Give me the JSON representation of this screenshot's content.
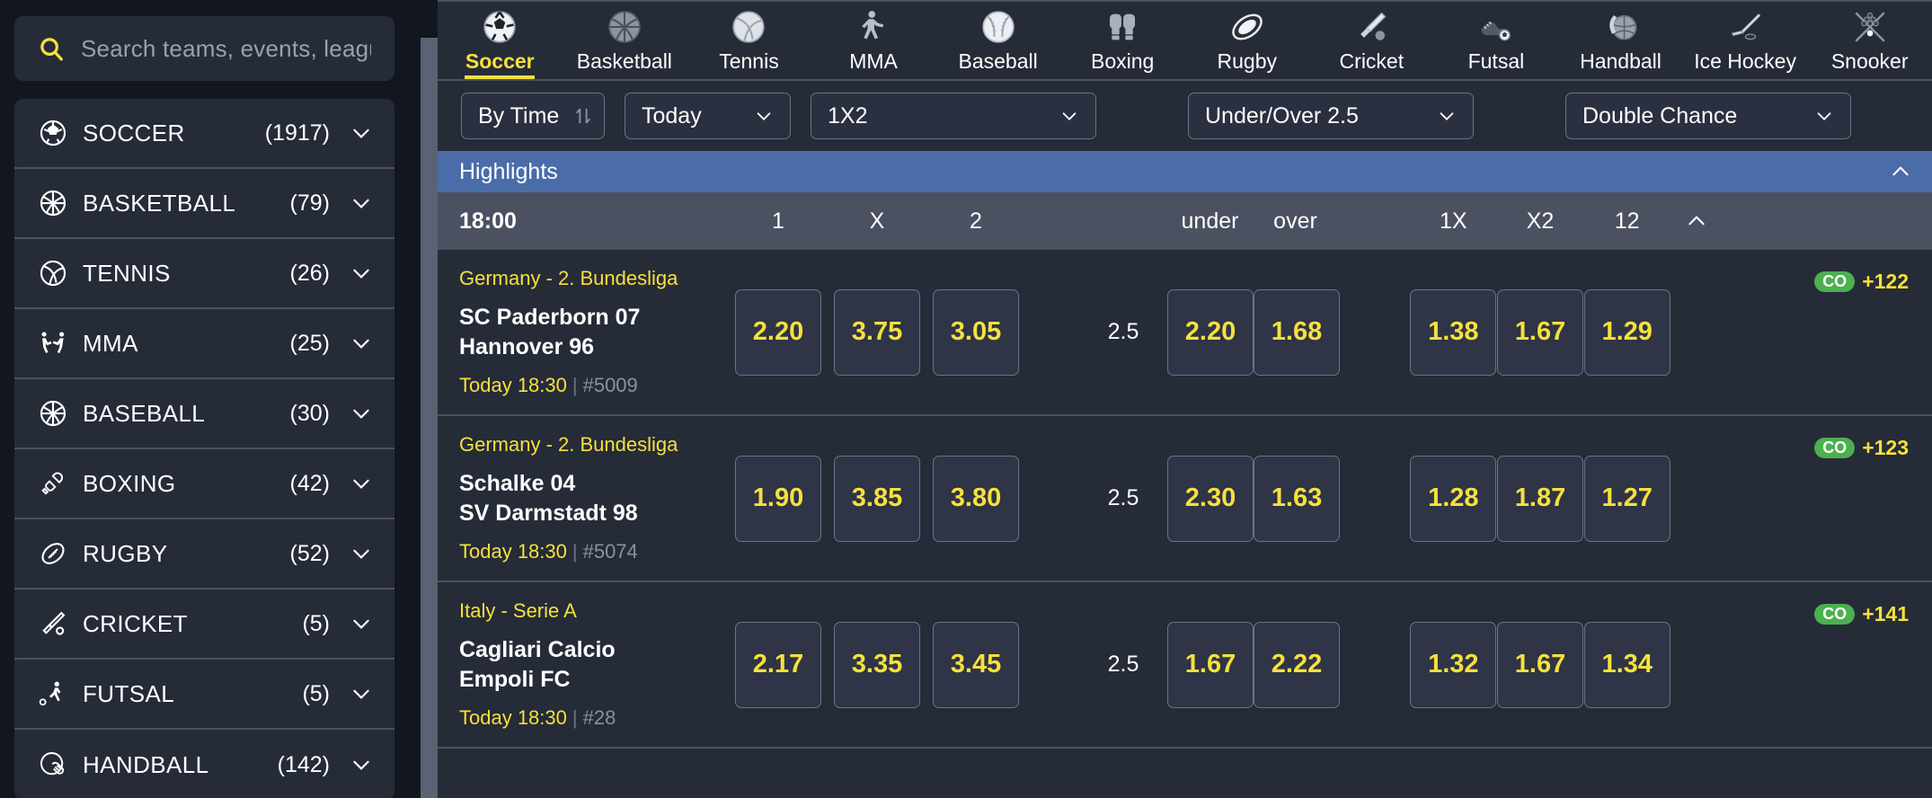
{
  "colors": {
    "accent_yellow": "#f5e13c",
    "highlight_blue": "#4a6ca8",
    "panel_bg": "#262b38",
    "page_bg": "#12161f",
    "row_header_bg": "#4b5161",
    "badge_green": "#4caf50"
  },
  "sidebar": {
    "search": {
      "placeholder": "Search teams, events, leagues",
      "icon": "search-icon",
      "value": ""
    },
    "items": [
      {
        "label": "SOCCER",
        "count": "(1917)",
        "icon": "soccer-ball-icon"
      },
      {
        "label": "BASKETBALL",
        "count": "(79)",
        "icon": "basketball-icon"
      },
      {
        "label": "TENNIS",
        "count": "(26)",
        "icon": "tennis-ball-icon"
      },
      {
        "label": "MMA",
        "count": "(25)",
        "icon": "mma-fighters-icon"
      },
      {
        "label": "BASEBALL",
        "count": "(30)",
        "icon": "baseball-icon"
      },
      {
        "label": "BOXING",
        "count": "(42)",
        "icon": "boxing-gloves-icon"
      },
      {
        "label": "RUGBY",
        "count": "(52)",
        "icon": "rugby-ball-icon"
      },
      {
        "label": "CRICKET",
        "count": "(5)",
        "icon": "cricket-bat-icon"
      },
      {
        "label": "FUTSAL",
        "count": "(5)",
        "icon": "futsal-player-icon"
      },
      {
        "label": "HANDBALL",
        "count": "(142)",
        "icon": "handball-icon"
      }
    ]
  },
  "topnav": {
    "items": [
      {
        "label": "Soccer",
        "icon": "soccer-ball-icon",
        "active": true
      },
      {
        "label": "Basketball",
        "icon": "basketball-icon",
        "active": false
      },
      {
        "label": "Tennis",
        "icon": "tennis-ball-icon",
        "active": false
      },
      {
        "label": "MMA",
        "icon": "mma-fighter-icon",
        "active": false
      },
      {
        "label": "Baseball",
        "icon": "baseball-icon",
        "active": false
      },
      {
        "label": "Boxing",
        "icon": "boxing-gloves-icon",
        "active": false
      },
      {
        "label": "Rugby",
        "icon": "rugby-ball-icon",
        "active": false
      },
      {
        "label": "Cricket",
        "icon": "cricket-bat-icon",
        "active": false
      },
      {
        "label": "Futsal",
        "icon": "futsal-boot-icon",
        "active": false
      },
      {
        "label": "Handball",
        "icon": "handball-icon",
        "active": false
      },
      {
        "label": "Ice Hockey",
        "icon": "hockey-stick-icon",
        "active": false
      },
      {
        "label": "Snooker",
        "icon": "snooker-cues-icon",
        "active": false
      }
    ]
  },
  "filters": {
    "sort": {
      "label": "By Time",
      "icon": "sort-updown-icon"
    },
    "day": {
      "label": "Today",
      "icon": "chevron-down-icon"
    },
    "market1": {
      "label": "1X2",
      "icon": "chevron-down-icon"
    },
    "market2": {
      "label": "Under/Over 2.5",
      "icon": "chevron-down-icon"
    },
    "market3": {
      "label": "Double Chance",
      "icon": "chevron-down-icon"
    }
  },
  "highlights": {
    "title": "Highlights",
    "collapse_icon": "chevron-up-icon"
  },
  "column_header": {
    "time": "18:00",
    "c1": "1",
    "cx": "X",
    "c2": "2",
    "line": "",
    "under": "under",
    "over": "over",
    "c1x": "1X",
    "cx2": "X2",
    "c12": "12",
    "collapse_icon": "chevron-up-icon"
  },
  "matches": [
    {
      "league": "Germany - 2. Bundesliga",
      "home": "SC Paderborn 07",
      "away": "Hannover 96",
      "kickoff": "Today 18:30",
      "sep": "|",
      "event_id": "#5009",
      "badge_label": "CO",
      "more_markets": "+122",
      "odds_1": "2.20",
      "odds_x": "3.75",
      "odds_2": "3.05",
      "line": "2.5",
      "odds_under": "2.20",
      "odds_over": "1.68",
      "odds_1x": "1.38",
      "odds_x2": "1.67",
      "odds_12": "1.29"
    },
    {
      "league": "Germany - 2. Bundesliga",
      "home": "Schalke 04",
      "away": "SV Darmstadt 98",
      "kickoff": "Today 18:30",
      "sep": "|",
      "event_id": "#5074",
      "badge_label": "CO",
      "more_markets": "+123",
      "odds_1": "1.90",
      "odds_x": "3.85",
      "odds_2": "3.80",
      "line": "2.5",
      "odds_under": "2.30",
      "odds_over": "1.63",
      "odds_1x": "1.28",
      "odds_x2": "1.87",
      "odds_12": "1.27"
    },
    {
      "league": "Italy - Serie A",
      "home": "Cagliari Calcio",
      "away": "Empoli FC",
      "kickoff": "Today 18:30",
      "sep": "|",
      "event_id": "#28",
      "badge_label": "CO",
      "more_markets": "+141",
      "odds_1": "2.17",
      "odds_x": "3.35",
      "odds_2": "3.45",
      "line": "2.5",
      "odds_under": "1.67",
      "odds_over": "2.22",
      "odds_1x": "1.32",
      "odds_x2": "1.67",
      "odds_12": "1.34"
    }
  ]
}
